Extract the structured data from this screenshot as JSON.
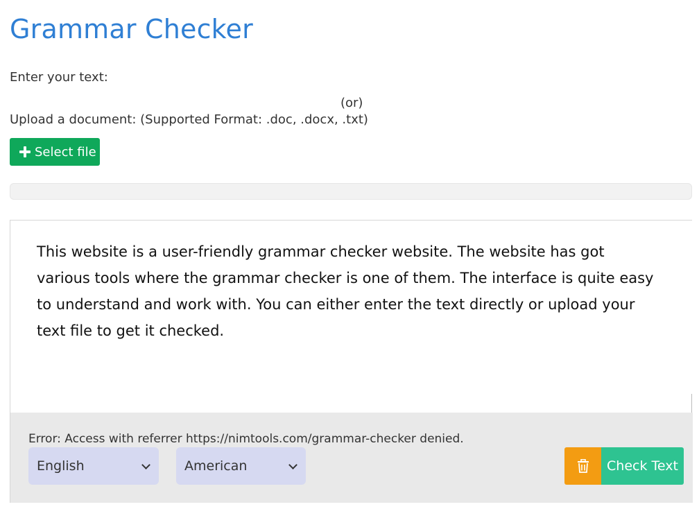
{
  "header": {
    "title": "Grammar Checker"
  },
  "input_section": {
    "enter_label": "Enter your text:",
    "or_label": "(or)",
    "upload_label": "Upload a document: (Supported Format: .doc, .docx, .txt)",
    "select_file_label": "Select file"
  },
  "editor": {
    "text": "This website is a user-friendly grammar checker website. The website has got various tools where the grammar checker is one of them. The interface is quite easy to understand and work with. You can either enter the text directly or upload your text file to get it checked."
  },
  "bottom_bar": {
    "error_message": "Error: Access with referrer https://nimtools.com/grammar-checker denied.",
    "language_selected": "English",
    "dialect_selected": "American",
    "check_label": "Check Text"
  },
  "icons": {
    "plus": "plus-icon",
    "chevron": "chevron-down-icon",
    "trash": "trash-icon"
  },
  "colors": {
    "title": "#2f7fd4",
    "select_file_btn": "#0fa85a",
    "trash_btn": "#f39c12",
    "check_btn": "#2ec391",
    "select_bg": "#d6d9f1"
  }
}
